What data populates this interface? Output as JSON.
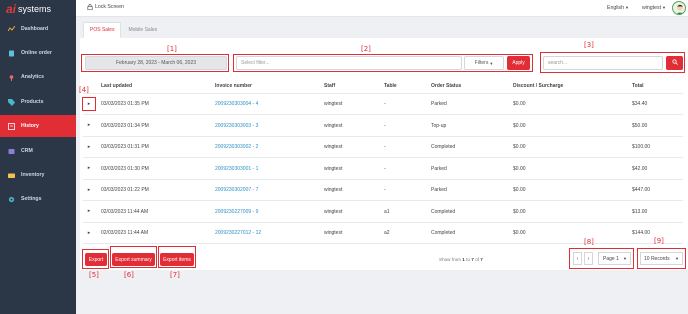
{
  "brand": {
    "logo": "ai",
    "name": "systems"
  },
  "sidebar": {
    "items": [
      {
        "label": "Dashboard",
        "icon": "dashboard-icon",
        "active": false
      },
      {
        "label": "Online order",
        "icon": "online-order-icon",
        "active": false
      },
      {
        "label": "Analytics",
        "icon": "analytics-icon",
        "active": false
      },
      {
        "label": "Products",
        "icon": "tag-icon",
        "active": false
      },
      {
        "label": "History",
        "icon": "history-icon",
        "active": true
      },
      {
        "label": "CRM",
        "icon": "crm-icon",
        "active": false
      },
      {
        "label": "Inventory",
        "icon": "inventory-icon",
        "active": false
      },
      {
        "label": "Settings",
        "icon": "gear-icon",
        "active": false
      }
    ]
  },
  "topbar": {
    "lock_label": "Lock Screen",
    "language": "English",
    "username": "wingtest"
  },
  "tabs": [
    {
      "label": "POS Sales",
      "active": true
    },
    {
      "label": "Mobile Sales",
      "active": false
    }
  ],
  "filters": {
    "date_range": "February 28, 2023 - March 06, 2023",
    "filter_placeholder": "Select filter...",
    "filters_label": "Filters",
    "apply_label": "Apply",
    "search_placeholder": "search..."
  },
  "table": {
    "headers": [
      "Last updated",
      "Invoice number",
      "Staff",
      "Table",
      "Order Status",
      "Discount / Surcharge",
      "Total"
    ],
    "rows": [
      {
        "last_updated": "03/03/2023 01:35 PM",
        "invoice": "2009230303004 - 4",
        "staff": "wingtest",
        "table": "-",
        "status": "Parked",
        "discount": "$0.00",
        "total": "$34.40"
      },
      {
        "last_updated": "03/03/2023 01:34 PM",
        "invoice": "2009230303003 - 3",
        "staff": "wingtest",
        "table": "-",
        "status": "Top-up",
        "discount": "$0.00",
        "total": "$50.00"
      },
      {
        "last_updated": "03/03/2023 01:31 PM",
        "invoice": "2009230303002 - 2",
        "staff": "wingtest",
        "table": "-",
        "status": "Completed",
        "discount": "$0.00",
        "total": "$100.00"
      },
      {
        "last_updated": "03/03/2023 01:30 PM",
        "invoice": "2009230303001 - 1",
        "staff": "wingtest",
        "table": "-",
        "status": "Parked",
        "discount": "$0.00",
        "total": "$42.00"
      },
      {
        "last_updated": "03/03/2023 01:22 PM",
        "invoice": "2009230302007 - 7",
        "staff": "wingtest",
        "table": "-",
        "status": "Parked",
        "discount": "$0.00",
        "total": "$447.00"
      },
      {
        "last_updated": "02/03/2023 11:44 AM",
        "invoice": "2009230227009 - 9",
        "staff": "wingtest",
        "table": "a1",
        "status": "Completed",
        "discount": "$0.00",
        "total": "$13.00"
      },
      {
        "last_updated": "02/03/2023 11:44 AM",
        "invoice": "2009230227012 - 12",
        "staff": "wingtest",
        "table": "a2",
        "status": "Completed",
        "discount": "$0.00",
        "total": "$144.00"
      }
    ]
  },
  "actions": {
    "export": "Export",
    "export_summary": "Export summary",
    "export_items": "Export items"
  },
  "pagination": {
    "showing_prefix": "Show from",
    "from": "1",
    "to_word": "to",
    "to": "7",
    "of_word": "of",
    "total": "7",
    "page_label": "Page 1",
    "records_label": "10 Records"
  },
  "markers": [
    "[1]",
    "[2]",
    "[3]",
    "[4]",
    "[5]",
    "[6]",
    "[7]",
    "[8]",
    "[9]"
  ],
  "colors": {
    "accent": "#e02d36",
    "sidebar": "#2b3646",
    "link": "#2f8fc5"
  }
}
